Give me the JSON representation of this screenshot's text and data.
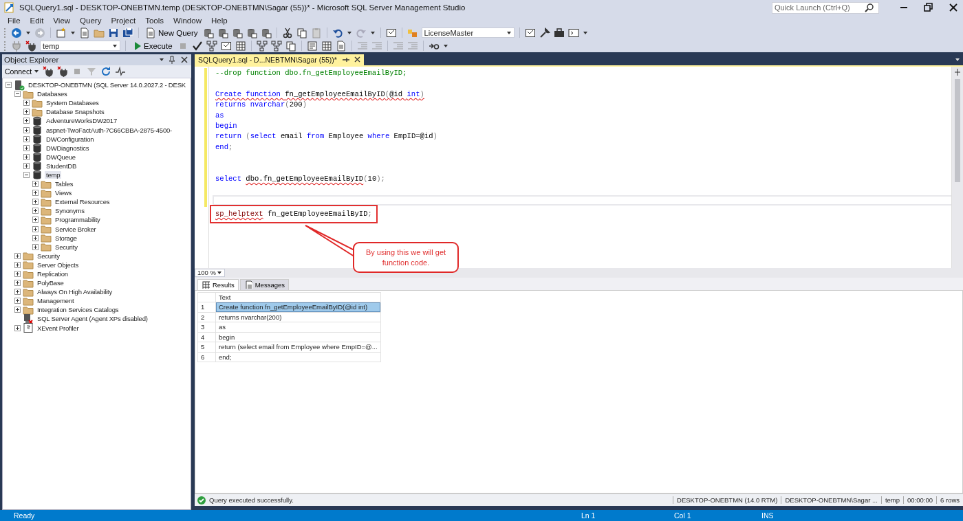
{
  "window": {
    "title": "SQLQuery1.sql - DESKTOP-ONEBTMN.temp (DESKTOP-ONEBTMN\\Sagar (55))* - Microsoft SQL Server Management Studio",
    "quick_launch": {
      "placeholder": "Quick Launch (Ctrl+Q)"
    }
  },
  "menu": [
    "File",
    "Edit",
    "View",
    "Query",
    "Project",
    "Tools",
    "Window",
    "Help"
  ],
  "toolbar": {
    "new_query": "New Query",
    "database_combo": "LicenseMaster",
    "current_database": "temp",
    "execute": "Execute"
  },
  "object_explorer": {
    "title": "Object Explorer",
    "connect": "Connect",
    "tree": [
      {
        "label": "DESKTOP-ONEBTMN (SQL Server 14.0.2027.2 - DESK",
        "kind": "server",
        "expanded": true,
        "selected": false,
        "children": [
          {
            "label": "Databases",
            "kind": "folder",
            "expanded": true,
            "selected": false,
            "children": [
              {
                "label": "System Databases",
                "kind": "folder",
                "expanded": false,
                "selected": false
              },
              {
                "label": "Database Snapshots",
                "kind": "folder",
                "expanded": false,
                "selected": false
              },
              {
                "label": "AdventureWorksDW2017",
                "kind": "database",
                "expanded": false,
                "selected": false
              },
              {
                "label": "aspnet-TwoFactAuth-7C66CBBA-2875-4500-",
                "kind": "database",
                "expanded": false,
                "selected": false
              },
              {
                "label": "DWConfiguration",
                "kind": "database",
                "expanded": false,
                "selected": false
              },
              {
                "label": "DWDiagnostics",
                "kind": "database",
                "expanded": false,
                "selected": false
              },
              {
                "label": "DWQueue",
                "kind": "database",
                "expanded": false,
                "selected": false
              },
              {
                "label": "StudentDB",
                "kind": "database",
                "expanded": false,
                "selected": false
              },
              {
                "label": "temp",
                "kind": "database",
                "expanded": true,
                "selected": true,
                "children": [
                  {
                    "label": "Tables",
                    "kind": "folder",
                    "expanded": false,
                    "selected": false
                  },
                  {
                    "label": "Views",
                    "kind": "folder",
                    "expanded": false,
                    "selected": false
                  },
                  {
                    "label": "External Resources",
                    "kind": "folder",
                    "expanded": false,
                    "selected": false
                  },
                  {
                    "label": "Synonyms",
                    "kind": "folder",
                    "expanded": false,
                    "selected": false
                  },
                  {
                    "label": "Programmability",
                    "kind": "folder",
                    "expanded": false,
                    "selected": false
                  },
                  {
                    "label": "Service Broker",
                    "kind": "folder",
                    "expanded": false,
                    "selected": false
                  },
                  {
                    "label": "Storage",
                    "kind": "folder",
                    "expanded": false,
                    "selected": false
                  },
                  {
                    "label": "Security",
                    "kind": "folder",
                    "expanded": false,
                    "selected": false
                  }
                ]
              }
            ]
          },
          {
            "label": "Security",
            "kind": "folder",
            "expanded": false,
            "selected": false
          },
          {
            "label": "Server Objects",
            "kind": "folder",
            "expanded": false,
            "selected": false
          },
          {
            "label": "Replication",
            "kind": "folder",
            "expanded": false,
            "selected": false
          },
          {
            "label": "PolyBase",
            "kind": "folder",
            "expanded": false,
            "selected": false
          },
          {
            "label": "Always On High Availability",
            "kind": "folder",
            "expanded": false,
            "selected": false
          },
          {
            "label": "Management",
            "kind": "folder",
            "expanded": false,
            "selected": false
          },
          {
            "label": "Integration Services Catalogs",
            "kind": "folder",
            "expanded": false,
            "selected": false
          },
          {
            "label": "SQL Server Agent (Agent XPs disabled)",
            "kind": "agent",
            "selected": false
          },
          {
            "label": "XEvent Profiler",
            "kind": "profiler",
            "expanded": false,
            "selected": false
          }
        ]
      }
    ]
  },
  "editor": {
    "tab": {
      "label": "SQLQuery1.sql - D...NEBTMN\\Sagar (55))*",
      "selected": true
    },
    "lines": [
      {
        "kind": "code",
        "tokens": [
          {
            "text": "--drop function dbo.fn_getEmployeeEmailByID;",
            "kind": "comment",
            "error": false
          }
        ]
      },
      {
        "kind": "blank"
      },
      {
        "kind": "code",
        "tokens": [
          {
            "text": "Create function ",
            "kind": "keyword",
            "error": true
          },
          {
            "text": "fn_getEmployeeEmailByID",
            "kind": "ident",
            "error": true
          },
          {
            "text": "(",
            "kind": "punct",
            "error": true
          },
          {
            "text": "@id ",
            "kind": "ident",
            "error": true
          },
          {
            "text": "int",
            "kind": "keyword",
            "error": true
          },
          {
            "text": ")",
            "kind": "punct",
            "error": true
          }
        ]
      },
      {
        "kind": "code",
        "tokens": [
          {
            "text": "returns nvarchar",
            "kind": "keyword",
            "error": false
          },
          {
            "text": "(",
            "kind": "punct",
            "error": false
          },
          {
            "text": "200",
            "kind": "ident",
            "error": false
          },
          {
            "text": ")",
            "kind": "punct",
            "error": false
          }
        ]
      },
      {
        "kind": "code",
        "tokens": [
          {
            "text": "as",
            "kind": "keyword",
            "error": false
          }
        ]
      },
      {
        "kind": "code",
        "tokens": [
          {
            "text": "begin",
            "kind": "keyword",
            "error": false
          }
        ]
      },
      {
        "kind": "code",
        "tokens": [
          {
            "text": "return ",
            "kind": "keyword",
            "error": false
          },
          {
            "text": "(",
            "kind": "punct",
            "error": false
          },
          {
            "text": "select ",
            "kind": "keyword",
            "error": false
          },
          {
            "text": "email ",
            "kind": "ident",
            "error": false
          },
          {
            "text": "from ",
            "kind": "keyword",
            "error": false
          },
          {
            "text": "Employee ",
            "kind": "ident",
            "error": false
          },
          {
            "text": "where ",
            "kind": "keyword",
            "error": false
          },
          {
            "text": "EmpID",
            "kind": "ident",
            "error": false
          },
          {
            "text": "=",
            "kind": "punct",
            "error": false
          },
          {
            "text": "@id",
            "kind": "ident",
            "error": false
          },
          {
            "text": ")",
            "kind": "punct",
            "error": false
          }
        ]
      },
      {
        "kind": "code",
        "tokens": [
          {
            "text": "end",
            "kind": "keyword",
            "error": false
          },
          {
            "text": ";",
            "kind": "punct",
            "error": false
          }
        ]
      },
      {
        "kind": "blank"
      },
      {
        "kind": "blank"
      },
      {
        "kind": "code",
        "tokens": [
          {
            "text": "select ",
            "kind": "keyword",
            "error": false
          },
          {
            "text": "dbo.fn_getEmployeeEmailByID",
            "kind": "ident",
            "error": true
          },
          {
            "text": "(",
            "kind": "punct",
            "error": false
          },
          {
            "text": "10",
            "kind": "ident",
            "error": false
          },
          {
            "text": ")",
            "kind": "punct",
            "error": false
          },
          {
            "text": ";",
            "kind": "punct",
            "error": false
          }
        ]
      },
      {
        "kind": "blank"
      },
      {
        "kind": "cursor"
      },
      {
        "kind": "boxed",
        "tokens": [
          {
            "text": "sp_helptext",
            "kind": "sysproc",
            "error": true
          },
          {
            "text": " fn_getEmployeeEmailByID",
            "kind": "ident",
            "error": false
          },
          {
            "text": ";",
            "kind": "punct",
            "error": false
          }
        ]
      }
    ],
    "callout": "By using this we will get function code.",
    "zoom": "100 %"
  },
  "results": {
    "tabs": [
      {
        "label": "Results",
        "selected": true
      },
      {
        "label": "Messages",
        "selected": false
      }
    ],
    "columns": [
      "Text"
    ],
    "rows": [
      {
        "number": "1",
        "text": "Create function fn_getEmployeeEmailByID(@id int)",
        "selected": true
      },
      {
        "number": "2",
        "text": "returns nvarchar(200)",
        "selected": false
      },
      {
        "number": "3",
        "text": "as",
        "selected": false
      },
      {
        "number": "4",
        "text": "begin",
        "selected": false
      },
      {
        "number": "5",
        "text": "return (select email from Employee where EmpID=@...",
        "selected": false
      },
      {
        "number": "6",
        "text": "end;",
        "selected": false
      }
    ]
  },
  "query_status": {
    "message": "Query executed successfully.",
    "server": "DESKTOP-ONEBTMN (14.0 RTM)",
    "user": "DESKTOP-ONEBTMN\\Sagar ...",
    "database": "temp",
    "elapsed": "00:00:00",
    "rows": "6 rows"
  },
  "status_bar": {
    "state": "Ready",
    "line": "Ln 1",
    "column": "Col 1",
    "mode": "INS"
  }
}
